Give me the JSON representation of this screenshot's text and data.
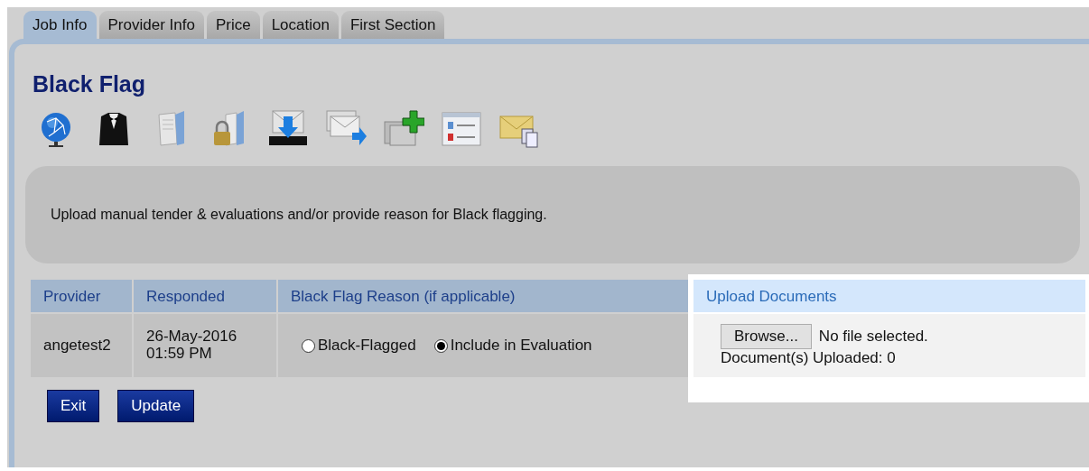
{
  "tabs": [
    {
      "label": "Job Info",
      "selected": true
    },
    {
      "label": "Provider Info",
      "selected": false
    },
    {
      "label": "Price",
      "selected": false
    },
    {
      "label": "Location",
      "selected": false
    },
    {
      "label": "First Section",
      "selected": false
    }
  ],
  "title": "Black Flag",
  "message": "Upload manual tender & evaluations and/or provide reason for Black flagging.",
  "table": {
    "columns": [
      "Provider",
      "Responded",
      "Black Flag Reason (if applicable)",
      "Upload Documents"
    ],
    "rows": [
      {
        "provider": "angetest2",
        "responded": "26-May-2016\n01:59 PM",
        "reason_options": [
          {
            "label": "Black-Flagged",
            "selected": false
          },
          {
            "label": "Include in Evaluation",
            "selected": true
          }
        ],
        "upload": {
          "highlighted": true,
          "browse_button": "Browse...",
          "file_status": "No file selected.",
          "uploaded": "Document(s) Uploaded: 0"
        }
      }
    ]
  },
  "buttons": [
    "Exit",
    "Update"
  ]
}
